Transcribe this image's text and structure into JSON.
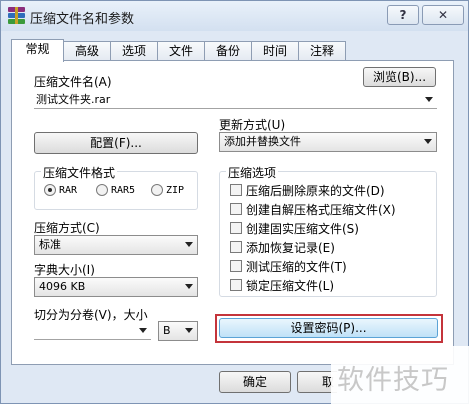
{
  "window": {
    "title": "压缩文件名和参数",
    "help_label": "?",
    "close_label": "✕"
  },
  "tabs": [
    {
      "label": "常规",
      "active": true
    },
    {
      "label": "高级"
    },
    {
      "label": "选项"
    },
    {
      "label": "文件"
    },
    {
      "label": "备份"
    },
    {
      "label": "时间"
    },
    {
      "label": "注释"
    }
  ],
  "archive_name": {
    "label": "压缩文件名(A)",
    "browse_label": "浏览(B)...",
    "value": "测试文件夹.rar"
  },
  "update_mode": {
    "label": "更新方式(U)",
    "value": "添加并替换文件"
  },
  "profiles_button": "配置(F)...",
  "archive_format": {
    "title": "压缩文件格式",
    "options": [
      {
        "label": "RAR",
        "selected": true
      },
      {
        "label": "RAR5",
        "selected": false
      },
      {
        "label": "ZIP",
        "selected": false
      }
    ]
  },
  "compression_method": {
    "label": "压缩方式(C)",
    "value": "标准"
  },
  "dictionary_size": {
    "label": "字典大小(I)",
    "value": "4096 KB"
  },
  "split_volumes": {
    "label": "切分为分卷(V)，大小",
    "value": "",
    "unit": "B"
  },
  "archive_options": {
    "title": "压缩选项",
    "items": [
      {
        "label": "压缩后删除原来的文件(D)",
        "checked": false
      },
      {
        "label": "创建自解压格式压缩文件(X)",
        "checked": false
      },
      {
        "label": "创建固实压缩文件(S)",
        "checked": false
      },
      {
        "label": "添加恢复记录(E)",
        "checked": false
      },
      {
        "label": "测试压缩的文件(T)",
        "checked": false
      },
      {
        "label": "锁定压缩文件(L)",
        "checked": false
      }
    ]
  },
  "set_password_button": "设置密码(P)...",
  "footer": {
    "ok_label": "确定",
    "cancel_label": "取"
  },
  "watermark": "软件技巧",
  "colors": {
    "highlight_border": "#c4343b",
    "focus_button": "#bfe1f7"
  }
}
